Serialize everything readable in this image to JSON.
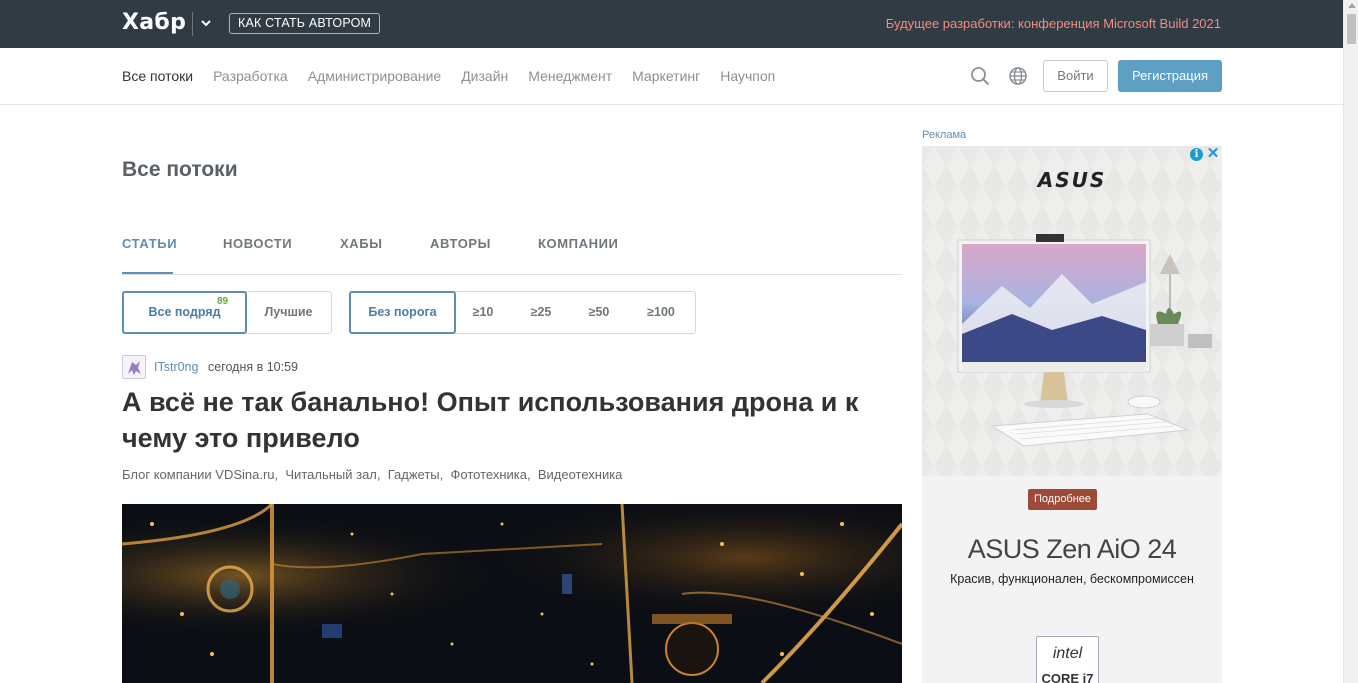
{
  "topbar": {
    "logo": "Хабр",
    "author_button": "КАК СТАТЬ АВТОРОМ",
    "promo": "Будущее разработки: конференция Microsoft Build 2021"
  },
  "nav": {
    "items": [
      "Все потоки",
      "Разработка",
      "Администрирование",
      "Дизайн",
      "Менеджмент",
      "Маркетинг",
      "Научпоп"
    ],
    "login": "Войти",
    "register": "Регистрация"
  },
  "main": {
    "title": "Все потоки",
    "tabs": [
      "СТАТЬИ",
      "НОВОСТИ",
      "ХАБЫ",
      "АВТОРЫ",
      "КОМПАНИИ"
    ],
    "filter_sort": {
      "all": "Все подряд",
      "all_count": "89",
      "best": "Лучшие"
    },
    "filter_threshold": [
      "Без порога",
      "≥10",
      "≥25",
      "≥50",
      "≥100"
    ]
  },
  "post": {
    "author": "ITstr0ng",
    "time": "сегодня в 10:59",
    "title": "А всё не так банально! Опыт использования дрона и к чему это привело",
    "hubs": [
      "Блог компании VDSina.ru,",
      "Читальный зал,",
      "Гаджеты,",
      "Фототехника,",
      "Видеотехника"
    ]
  },
  "ad": {
    "label": "Реклама",
    "brand": "ASUS",
    "more_button": "Подробнее",
    "product": "ASUS Zen AiO 24",
    "tagline": "Красив, функционален, бескомпромиссен",
    "intel_logo": "intel",
    "intel_core": "CORE i7"
  },
  "colors": {
    "topbar_bg": "#303b44",
    "accent": "#5e8eb5",
    "register_bg": "#5e9fc4",
    "promo_text": "#f28d7f"
  }
}
